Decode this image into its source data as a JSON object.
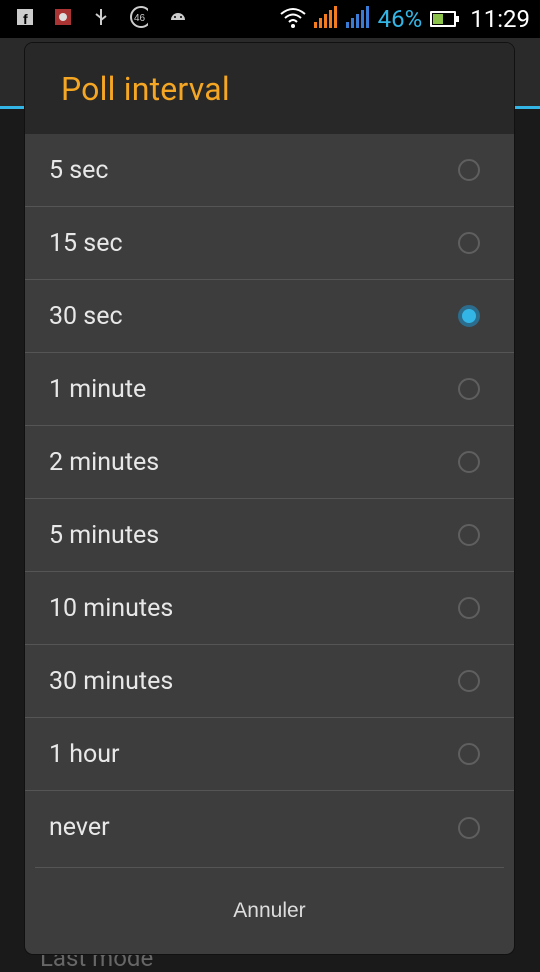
{
  "status_bar": {
    "battery_percent": "46%",
    "time": "11:29",
    "icons": [
      "facebook-icon",
      "app-icon",
      "usb-icon",
      "4g-icon",
      "android-icon",
      "wifi-icon",
      "signal-icon",
      "signal2-icon",
      "battery-icon"
    ]
  },
  "dialog": {
    "title": "Poll interval",
    "options": [
      {
        "label": "5 sec",
        "selected": false
      },
      {
        "label": "15 sec",
        "selected": false
      },
      {
        "label": "30 sec",
        "selected": true
      },
      {
        "label": "1 minute",
        "selected": false
      },
      {
        "label": "2 minutes",
        "selected": false
      },
      {
        "label": "5 minutes",
        "selected": false
      },
      {
        "label": "10 minutes",
        "selected": false
      },
      {
        "label": "30 minutes",
        "selected": false
      },
      {
        "label": "1 hour",
        "selected": false
      },
      {
        "label": "never",
        "selected": false
      }
    ],
    "cancel_label": "Annuler"
  },
  "background": {
    "peek_text": "Last mode"
  },
  "colors": {
    "accent": "#33b5e5",
    "title": "#f5a623"
  }
}
